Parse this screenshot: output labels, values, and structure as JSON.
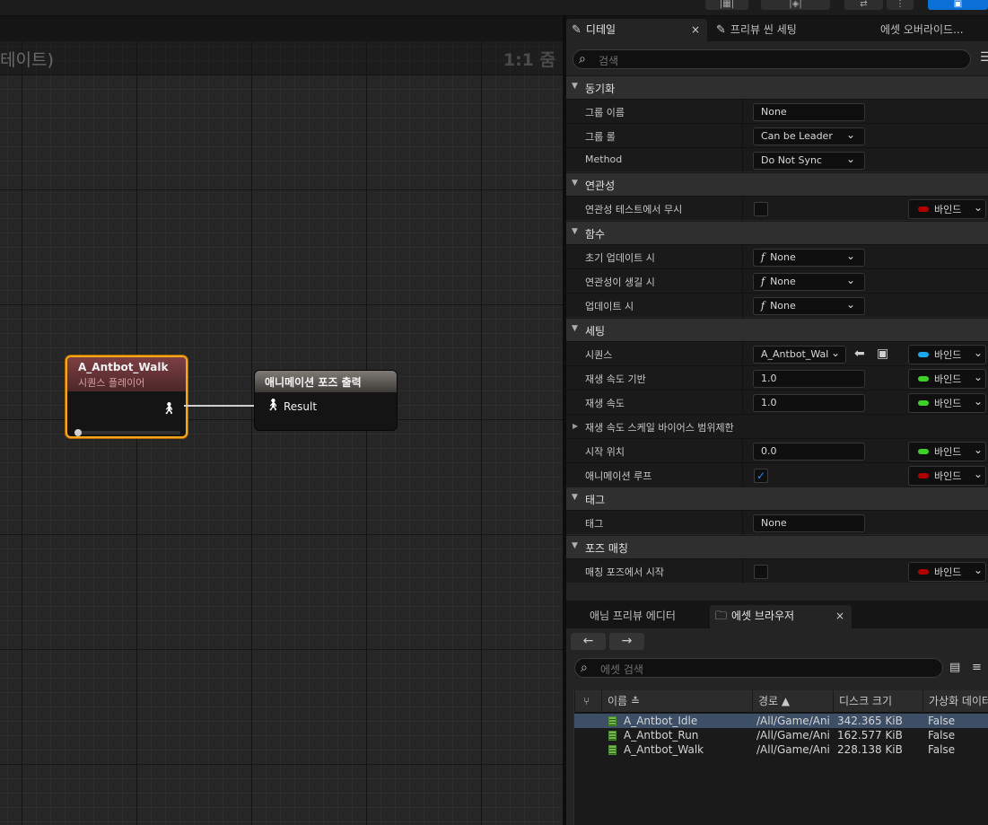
{
  "topbar": {
    "buttons": [
      "|▦|",
      "|◈|",
      "⇄",
      "⋮",
      "▣"
    ]
  },
  "graph": {
    "title": "테이트)",
    "zoom": "1:1 줌",
    "player_node": {
      "name": "A_Antbot_Walk",
      "subtitle": "시퀀스 플레이어"
    },
    "output_node": {
      "title": "애니메이션 포즈 출력",
      "pin_label": "Result"
    }
  },
  "details": {
    "tabs": [
      {
        "label": "디테일",
        "close": "×"
      },
      {
        "label": "프리뷰 씬 세팅"
      },
      {
        "label": "에셋 오버라이드..."
      }
    ],
    "search_placeholder": "검색",
    "categories": {
      "sync": "동기화",
      "relevance": "연관성",
      "functions": "함수",
      "settings": "세팅",
      "tag": "태그",
      "pose_matching": "포즈 매칭"
    },
    "rows": {
      "group_name": {
        "label": "그룹 이름",
        "value": "None"
      },
      "group_role": {
        "label": "그룹 롤",
        "value": "Can be Leader"
      },
      "method": {
        "label": "Method",
        "value": "Do Not Sync"
      },
      "ignore_relevancy": {
        "label": "연관성 테스트에서 무시",
        "checked": false,
        "bind": "바인드"
      },
      "initial_update": {
        "label": "초기 업데이트 시",
        "value": "None"
      },
      "on_become_relevant": {
        "label": "연관성이 생길 시",
        "value": "None"
      },
      "on_update": {
        "label": "업데이트 시",
        "value": "None"
      },
      "sequence": {
        "label": "시퀀스",
        "value": "A_Antbot_Wal",
        "bind": "바인드"
      },
      "play_rate_basis": {
        "label": "재생 속도 기반",
        "value": "1.0",
        "bind": "바인드"
      },
      "play_rate": {
        "label": "재생 속도",
        "value": "1.0",
        "bind": "바인드"
      },
      "play_rate_scale": {
        "label": "재생 속도 스케일 바이어스 범위제한"
      },
      "start_position": {
        "label": "시작 위치",
        "value": "0.0",
        "bind": "바인드"
      },
      "loop_animation": {
        "label": "애니메이션 루프",
        "checked": true,
        "bind": "바인드"
      },
      "tag": {
        "label": "태그",
        "value": "None"
      },
      "start_from_matching_pose": {
        "label": "매칭 포즈에서 시작",
        "checked": false,
        "bind": "바인드"
      }
    },
    "bind_colors": {
      "red": "#b00000",
      "blue": "#1ea7e8",
      "green": "#3ecf2a"
    }
  },
  "asset_browser": {
    "tabs": [
      {
        "label": "애님 프리뷰 에디터"
      },
      {
        "label": "에셋 브라우저",
        "close": "×"
      }
    ],
    "search_placeholder": "에셋 검색",
    "columns": [
      "이름",
      "경로",
      "디스크 크기",
      "가상화 데이터"
    ],
    "sort_indicators": {
      "name": "≛",
      "path": "▲"
    },
    "rows": [
      {
        "name": "A_Antbot_Idle",
        "path": "/All/Game/Ani",
        "size": "342.365 KiB",
        "virtualized": "False",
        "selected": true
      },
      {
        "name": "A_Antbot_Run",
        "path": "/All/Game/Ani",
        "size": "162.577 KiB",
        "virtualized": "False",
        "selected": false
      },
      {
        "name": "A_Antbot_Walk",
        "path": "/All/Game/Ani",
        "size": "228.138 KiB",
        "virtualized": "False",
        "selected": false
      }
    ]
  }
}
